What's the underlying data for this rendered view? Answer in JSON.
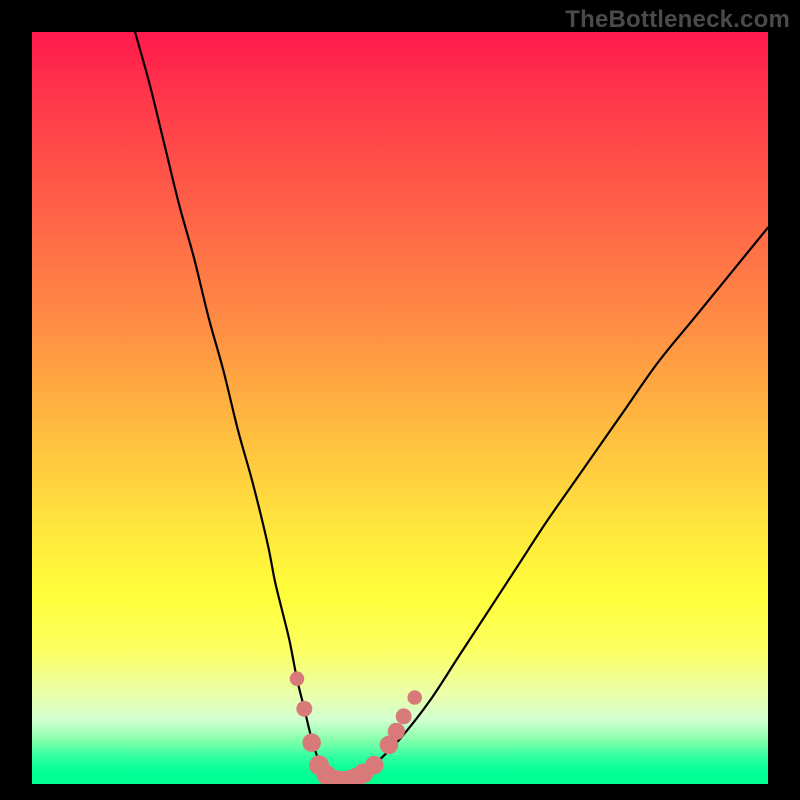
{
  "watermark": "TheBottleneck.com",
  "chart_data": {
    "type": "line",
    "title": "",
    "xlabel": "",
    "ylabel": "",
    "xlim": [
      0,
      100
    ],
    "ylim": [
      0,
      100
    ],
    "grid": false,
    "legend": false,
    "series": [
      {
        "name": "bottleneck-curve",
        "x": [
          14,
          16,
          18,
          20,
          22,
          24,
          26,
          28,
          30,
          32,
          33,
          34,
          35,
          36,
          37,
          38,
          39,
          40,
          41,
          42,
          43,
          44,
          45,
          47,
          50,
          54,
          58,
          62,
          66,
          70,
          75,
          80,
          85,
          90,
          95,
          100
        ],
        "y": [
          100,
          93,
          85,
          77,
          70,
          62,
          55,
          47,
          40,
          32,
          27,
          23,
          19,
          14,
          10,
          6,
          3,
          1,
          0,
          0,
          0,
          0,
          1,
          3,
          6,
          11,
          17,
          23,
          29,
          35,
          42,
          49,
          56,
          62,
          68,
          74
        ]
      }
    ],
    "markers": {
      "name": "highlight-dots",
      "color": "#d97a7a",
      "points": [
        {
          "x": 36.0,
          "y": 14.0,
          "r": 1.1
        },
        {
          "x": 37.0,
          "y": 10.0,
          "r": 1.2
        },
        {
          "x": 38.0,
          "y": 5.5,
          "r": 1.4
        },
        {
          "x": 39.0,
          "y": 2.5,
          "r": 1.5
        },
        {
          "x": 40.0,
          "y": 1.2,
          "r": 1.5
        },
        {
          "x": 41.0,
          "y": 0.6,
          "r": 1.5
        },
        {
          "x": 42.0,
          "y": 0.4,
          "r": 1.5
        },
        {
          "x": 43.0,
          "y": 0.5,
          "r": 1.5
        },
        {
          "x": 44.0,
          "y": 0.8,
          "r": 1.5
        },
        {
          "x": 45.0,
          "y": 1.4,
          "r": 1.5
        },
        {
          "x": 46.5,
          "y": 2.5,
          "r": 1.4
        },
        {
          "x": 48.5,
          "y": 5.2,
          "r": 1.4
        },
        {
          "x": 49.5,
          "y": 7.0,
          "r": 1.3
        },
        {
          "x": 50.5,
          "y": 9.0,
          "r": 1.2
        },
        {
          "x": 52.0,
          "y": 11.5,
          "r": 1.1
        }
      ]
    }
  }
}
